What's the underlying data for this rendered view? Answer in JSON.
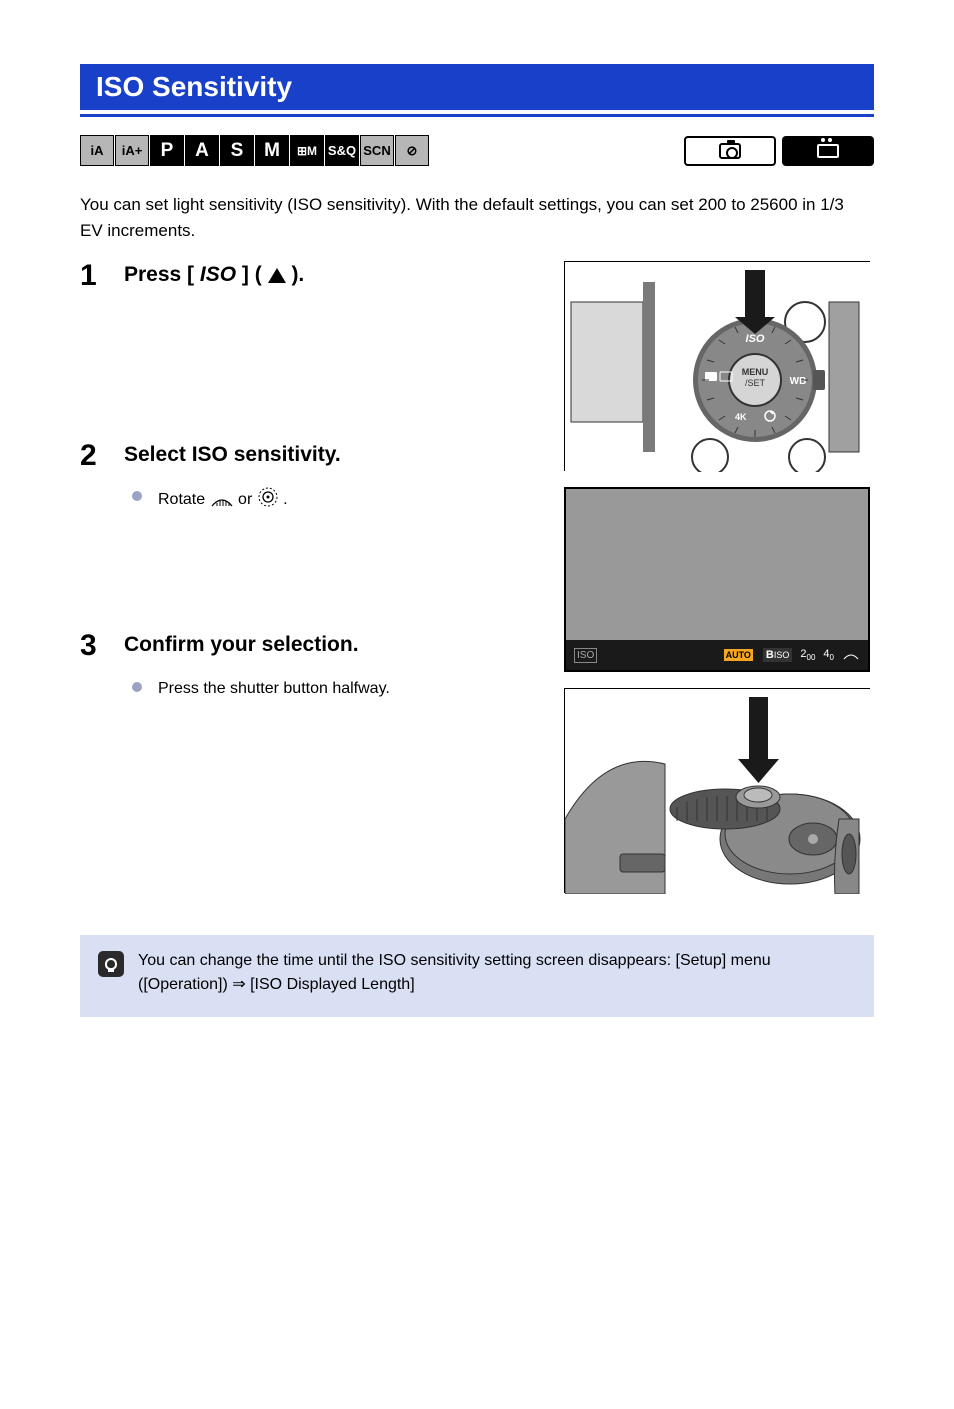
{
  "header": {
    "title": "ISO Sensitivity"
  },
  "modes": [
    "iA",
    "iA+",
    "P",
    "A",
    "S",
    "M",
    "⊞M",
    "S&Q",
    "SCN",
    "⊘"
  ],
  "intro": "You can set light sensitivity (ISO sensitivity). With the default settings, you can set 200 to 25600 in 1/3 EV increments.",
  "steps": {
    "s1": {
      "num": "1",
      "main_prefix": "Press [",
      "iso_text": "ISO",
      "main_suffix": "] (",
      "main_end": ")."
    },
    "s2": {
      "num": "2",
      "main": "Select ISO sensitivity.",
      "bullet_prefix": "Rotate ",
      "bullet_mid": " or ",
      "bullet_end": "."
    },
    "s3": {
      "num": "3",
      "main": "Confirm your selection.",
      "bullet": "Press the shutter button halfway."
    }
  },
  "img2_footer": {
    "left": "ISO",
    "auto": "AUTO",
    "b_iso": "ISO",
    "v1_a": "2",
    "v1_b": "00",
    "v2_a": "4",
    "v2_b": "0"
  },
  "tip": "You can change the time until the ISO sensitivity setting screen disappears: [Setup] menu ([Operation]) ⇒ [ISO Displayed Length]"
}
